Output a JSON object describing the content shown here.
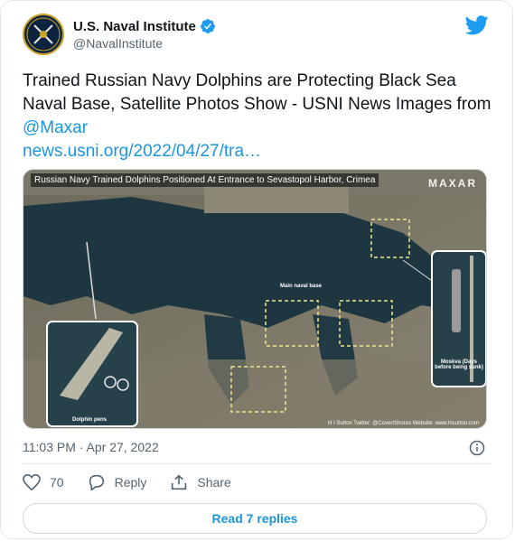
{
  "author": {
    "display_name": "U.S. Naval Institute",
    "handle": "@NavalInstitute"
  },
  "tweet": {
    "text": "Trained Russian Navy Dolphins are Protecting Black Sea Naval Base, Satellite Photos Show - USNI News Images from ",
    "mention": "@Maxar",
    "url": "news.usni.org/2022/04/27/tra…"
  },
  "media": {
    "caption": "Russian Navy Trained Dolphins Positioned At Entrance to Sevastopol Harbor, Crimea",
    "brand": "MAXAR",
    "labels": {
      "main_base": "Main naval base",
      "dolphin_pens": "Dolphin pens",
      "moskva": "Moskva (Days before being sunk)",
      "credit": "H I Sutton  Twitter: @CovertShores  Website: www.hisutton.com"
    }
  },
  "meta": {
    "timestamp": "11:03 PM · Apr 27, 2022"
  },
  "actions": {
    "likes": "70",
    "reply": "Reply",
    "share": "Share"
  },
  "replies_button": "Read 7 replies",
  "colors": {
    "link": "#1b95e0",
    "text": "#0f1419",
    "muted": "#536471"
  },
  "icons": [
    "verified-icon",
    "twitter-bird-icon",
    "info-icon",
    "heart-icon",
    "reply-icon",
    "share-icon"
  ]
}
